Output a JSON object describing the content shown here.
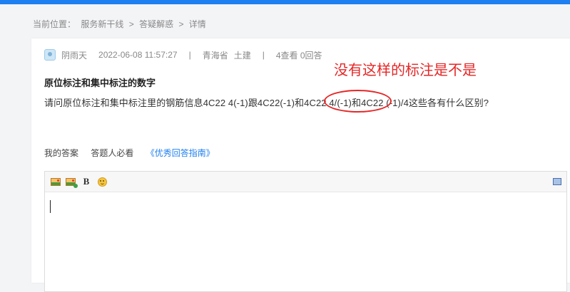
{
  "breadcrumb": {
    "label": "当前位置：",
    "item1": "服务新干线",
    "sep1": ">",
    "item2": "答疑解惑",
    "sep2": ">",
    "item3": "详情"
  },
  "post": {
    "author": "阴雨天",
    "datetime": "2022-06-08 11:57:27",
    "divider": "|",
    "location": "青海省",
    "category": "土建",
    "stats": "4查看 0回答",
    "title": "原位标注和集中标注的数字",
    "question": "请问原位标注和集中标注里的钢筋信息4C22 4(-1)跟4C22(-1)和4C22 4/(-1)和4C22 (-1)/4这些各有什么区别?"
  },
  "annotation": {
    "text": "没有这样的标注是不是",
    "color": "#e52727"
  },
  "tabs": {
    "my_answer": "我的答案",
    "must_read": "答题人必看",
    "guide_link": "《优秀回答指南》"
  },
  "editor": {
    "toolbar": [
      "image-icon",
      "upload-image-icon",
      "bold-icon",
      "emoji-icon",
      "fullscreen-icon"
    ],
    "bold_label": "B",
    "content": ""
  },
  "colors": {
    "accent": "#1e7ff0",
    "annotation": "#e52727"
  }
}
